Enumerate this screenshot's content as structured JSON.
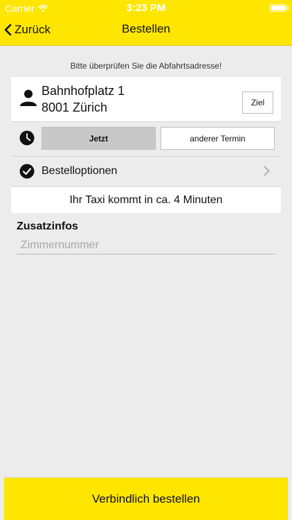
{
  "status_bar": {
    "carrier": "Carrier",
    "time": "3:23 PM"
  },
  "nav": {
    "back_label": "Zurück",
    "title": "Bestellen"
  },
  "hint": "Bitte überprüfen Sie die Abfahrtsadresse!",
  "address": {
    "street": "Bahnhofplatz 1",
    "city": "8001 Zürich",
    "destination_button": "Ziel"
  },
  "time_selector": {
    "now_label": "Jetzt",
    "other_label": "anderer Termin",
    "selected": "Jetzt"
  },
  "options": {
    "label": "Bestelloptionen"
  },
  "eta": "Ihr Taxi kommt in ca. 4 Minuten",
  "extra": {
    "title": "Zusatzinfos",
    "room_value": "",
    "room_placeholder": "Zimmernummer"
  },
  "order_button": "Verbindlich bestellen",
  "colors": {
    "accent": "#ffe600",
    "background": "#ececec",
    "segment_selected": "#c8c8c8"
  },
  "icons": [
    "wifi-icon",
    "battery-icon",
    "chevron-left-icon",
    "person-icon",
    "clock-icon",
    "checkmark-circle-icon",
    "chevron-right-icon"
  ]
}
